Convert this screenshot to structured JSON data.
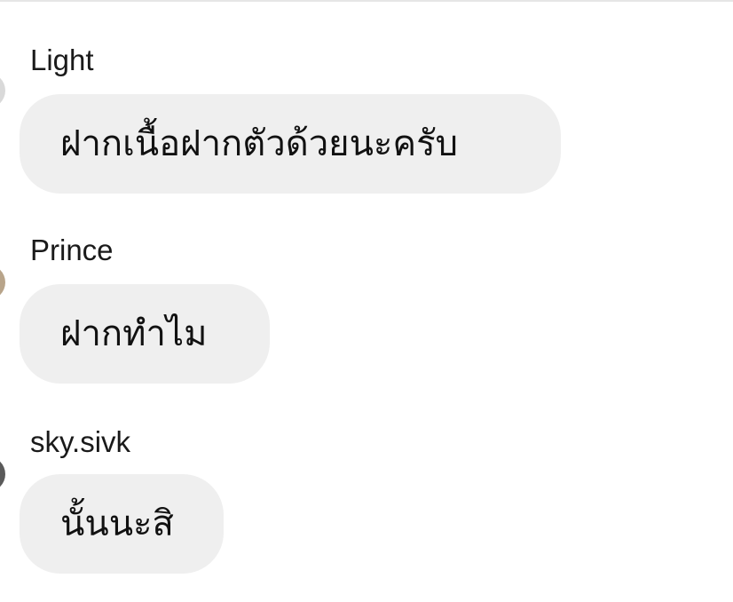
{
  "messages": [
    {
      "sender": "Light",
      "text": "ฝากเนื้อฝากตัวด้วยนะครับ",
      "avatar_color": "#d9d9d9"
    },
    {
      "sender": "Prince",
      "text": "ฝากทำไม",
      "avatar_color": "#b8a48a"
    },
    {
      "sender": "sky.sivk",
      "text": "นั้นนะสิ",
      "avatar_color": "#5a5a5a"
    }
  ],
  "colors": {
    "bubble": "#efefef",
    "text": "#111111",
    "sender": "#1a1a1a",
    "background": "#ffffff"
  }
}
